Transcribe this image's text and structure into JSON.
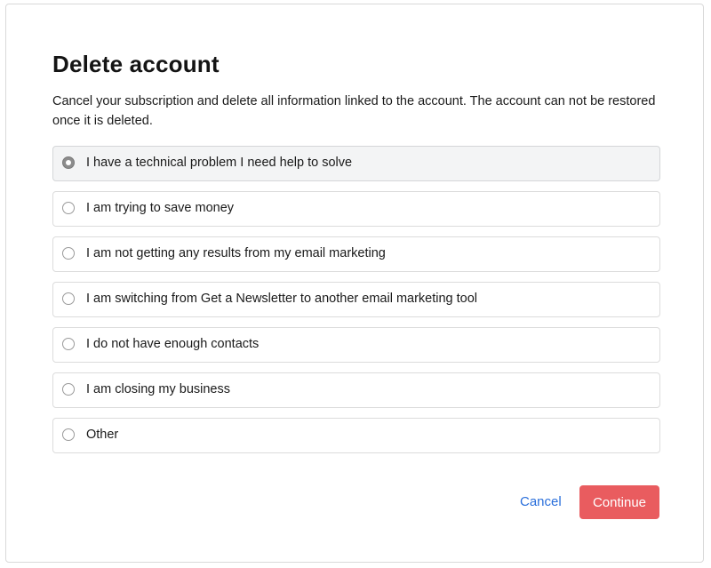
{
  "dialog": {
    "title": "Delete account",
    "description": "Cancel your subscription and delete all information linked to the account. The account can not be restored once it is deleted."
  },
  "reasons": {
    "selected_index": 0,
    "options": [
      {
        "label": "I have a technical problem I need help to solve",
        "selected": true
      },
      {
        "label": "I am trying to save money",
        "selected": false
      },
      {
        "label": "I am not getting any results from my email marketing",
        "selected": false
      },
      {
        "label": "I am switching from Get a Newsletter to another email marketing tool",
        "selected": false
      },
      {
        "label": "I do not have enough contacts",
        "selected": false
      },
      {
        "label": "I am closing my business",
        "selected": false
      },
      {
        "label": "Other",
        "selected": false
      }
    ]
  },
  "actions": {
    "cancel_label": "Cancel",
    "continue_label": "Continue"
  },
  "colors": {
    "accent_link": "#2a6fdb",
    "danger_button": "#e95c5f",
    "selected_background": "#f3f4f5"
  }
}
